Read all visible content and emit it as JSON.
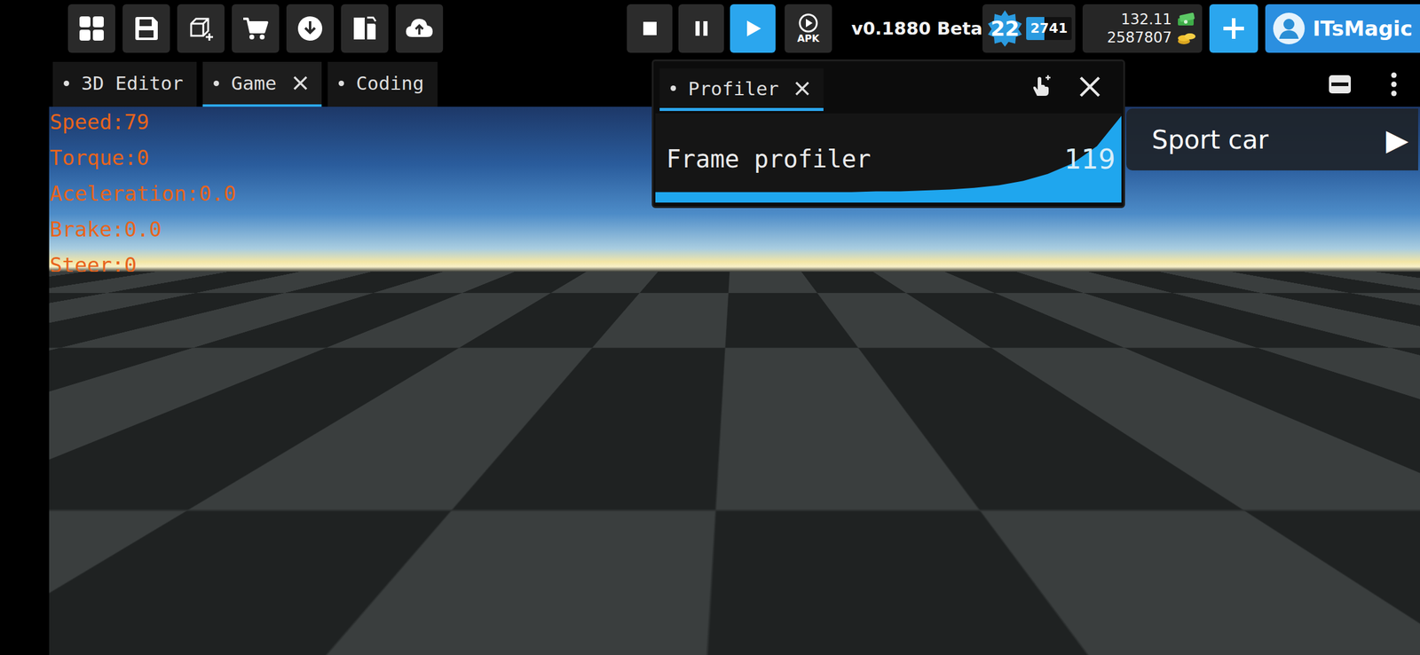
{
  "playback": [
    {
      "kind": "stop",
      "selected": false
    },
    {
      "kind": "pause",
      "selected": false
    },
    {
      "kind": "play",
      "selected": true
    }
  ],
  "apk_label": "APK",
  "version": "v0.1880 Beta",
  "player": {
    "level": "22",
    "xp": "2741",
    "xp_level": 0.4
  },
  "currency": {
    "cash": "132.11",
    "coins": "2587807"
  },
  "account": {
    "name": "ITsMagic"
  },
  "tabs": [
    {
      "label": "3D Editor",
      "selected": false,
      "closable": false
    },
    {
      "label": "Game",
      "selected": true,
      "closable": true
    },
    {
      "label": "Coding",
      "selected": false,
      "closable": false
    }
  ],
  "profiler": {
    "tab": {
      "label": "Profiler",
      "selected": true
    },
    "chart": {
      "title": "Frame profiler",
      "value": "119",
      "values": [
        12,
        12,
        12,
        12,
        12,
        12,
        12,
        12,
        12,
        13,
        13,
        14,
        15,
        17,
        20,
        25,
        33,
        45,
        65,
        100
      ]
    }
  },
  "hud": [
    "Speed:79",
    "Torque:0",
    "Aceleration:0.0",
    "Brake:0.0",
    "Steer:0"
  ],
  "vehicle_select": {
    "label": "Sport car",
    "arrow": "▶"
  }
}
